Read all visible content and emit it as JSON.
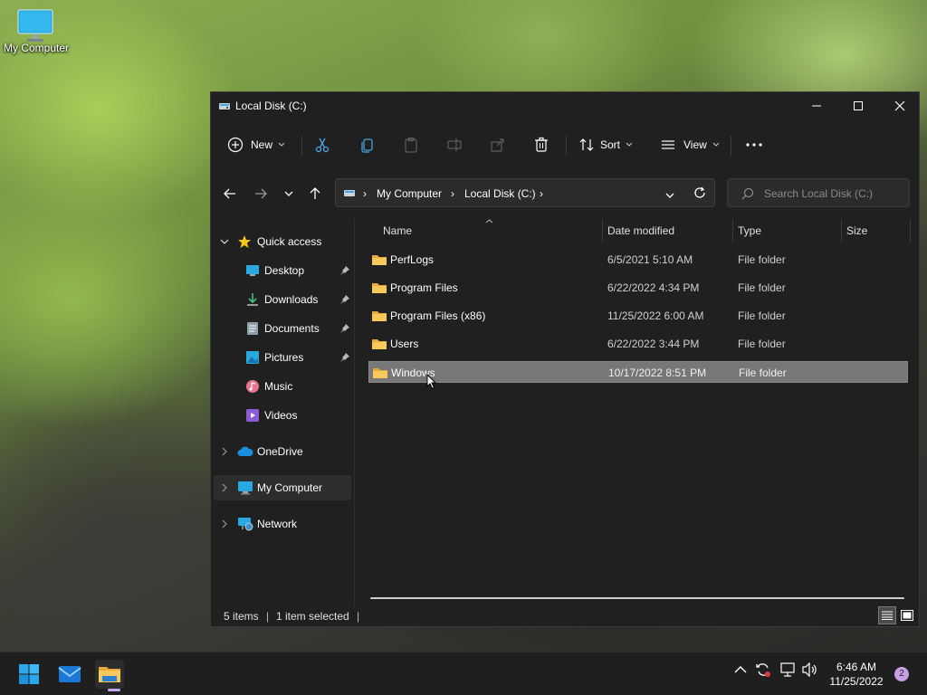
{
  "desktop": {
    "icons": [
      {
        "label": "My Computer",
        "icon": "monitor-icon"
      }
    ]
  },
  "window": {
    "title": "Local Disk (C:)",
    "controls": {
      "minimize": "minimize-icon",
      "maximize": "maximize-icon",
      "close": "close-icon"
    }
  },
  "toolbar": {
    "new_label": "New",
    "sort_label": "Sort",
    "view_label": "View",
    "icons": [
      "add-icon",
      "cut-icon",
      "copy-icon",
      "paste-icon",
      "rename-icon",
      "share-icon",
      "delete-icon",
      "sort-icon",
      "view-icon",
      "more-icon"
    ]
  },
  "address": {
    "crumbs": [
      "My Computer",
      "Local Disk (C:)"
    ],
    "search_placeholder": "Search Local Disk (C:)"
  },
  "sidebar": {
    "quick_access": "Quick access",
    "pinned": [
      {
        "label": "Desktop",
        "icon": "desktop-icon",
        "pinned": true
      },
      {
        "label": "Downloads",
        "icon": "downloads-icon",
        "pinned": true
      },
      {
        "label": "Documents",
        "icon": "documents-icon",
        "pinned": true
      },
      {
        "label": "Pictures",
        "icon": "pictures-icon",
        "pinned": true
      },
      {
        "label": "Music",
        "icon": "music-icon",
        "pinned": false
      },
      {
        "label": "Videos",
        "icon": "videos-icon",
        "pinned": false
      }
    ],
    "onedrive": "OneDrive",
    "this_pc": "My Computer",
    "network": "Network"
  },
  "columns": {
    "name": "Name",
    "date": "Date modified",
    "type": "Type",
    "size": "Size"
  },
  "files": [
    {
      "name": "PerfLogs",
      "date": "6/5/2021 5:10 AM",
      "type": "File folder",
      "selected": false
    },
    {
      "name": "Program Files",
      "date": "6/22/2022 4:34 PM",
      "type": "File folder",
      "selected": false
    },
    {
      "name": "Program Files (x86)",
      "date": "11/25/2022 6:00 AM",
      "type": "File folder",
      "selected": false
    },
    {
      "name": "Users",
      "date": "6/22/2022 3:44 PM",
      "type": "File folder",
      "selected": false
    },
    {
      "name": "Windows",
      "date": "10/17/2022 8:51 PM",
      "type": "File folder",
      "selected": true
    }
  ],
  "status": {
    "items": "5 items",
    "selected": "1 item selected"
  },
  "taskbar": {
    "apps": [
      "start-icon",
      "mail-icon",
      "file-explorer-icon"
    ],
    "tray": [
      "chevron-up-icon",
      "sync-icon",
      "network-icon",
      "volume-icon"
    ],
    "time": "6:46 AM",
    "date": "11/25/2022",
    "notifications": "2"
  },
  "colors": {
    "accent_folder": "#f2c14e",
    "selection": "#777777",
    "window_bg": "#202020",
    "taskbar_bg": "#1f1f1f"
  }
}
